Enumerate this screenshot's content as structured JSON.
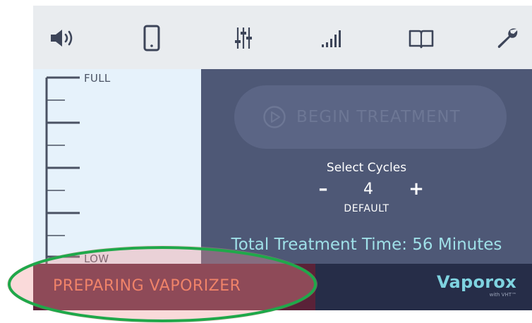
{
  "toolbar": {
    "items": [
      {
        "icon": "speaker-icon",
        "name": "sound"
      },
      {
        "icon": "phone-icon",
        "name": "device"
      },
      {
        "icon": "sliders-icon",
        "name": "adjustments"
      },
      {
        "icon": "signal-icon",
        "name": "signal"
      },
      {
        "icon": "book-icon",
        "name": "manual"
      },
      {
        "icon": "wrench-icon",
        "name": "service"
      }
    ]
  },
  "gauge": {
    "full_label": "FULL",
    "low_label": "LOW"
  },
  "treatment": {
    "begin_label": "BEGIN TREATMENT",
    "begin_enabled": false,
    "cycles_title": "Select Cycles",
    "minus_label": "–",
    "cycles_value": "4",
    "plus_label": "+",
    "cycles_note": "DEFAULT",
    "total_time": "Total Treatment Time: 56 Minutes"
  },
  "status": {
    "message": "PREPARING VAPORIZER",
    "brand": "Vaporox",
    "brand_sub": "with VHT™"
  },
  "colors": {
    "toolbar_bg": "#e9ecef",
    "icon": "#3d4559",
    "gauge_bg": "#e6f2fb",
    "panel_bg": "#4e5876",
    "status_bg": "#262d48",
    "status_alert_bg": "#5a2238",
    "status_text": "#f07a52",
    "accent": "#7fd3e0",
    "highlight_ring": "#1fa84a"
  }
}
